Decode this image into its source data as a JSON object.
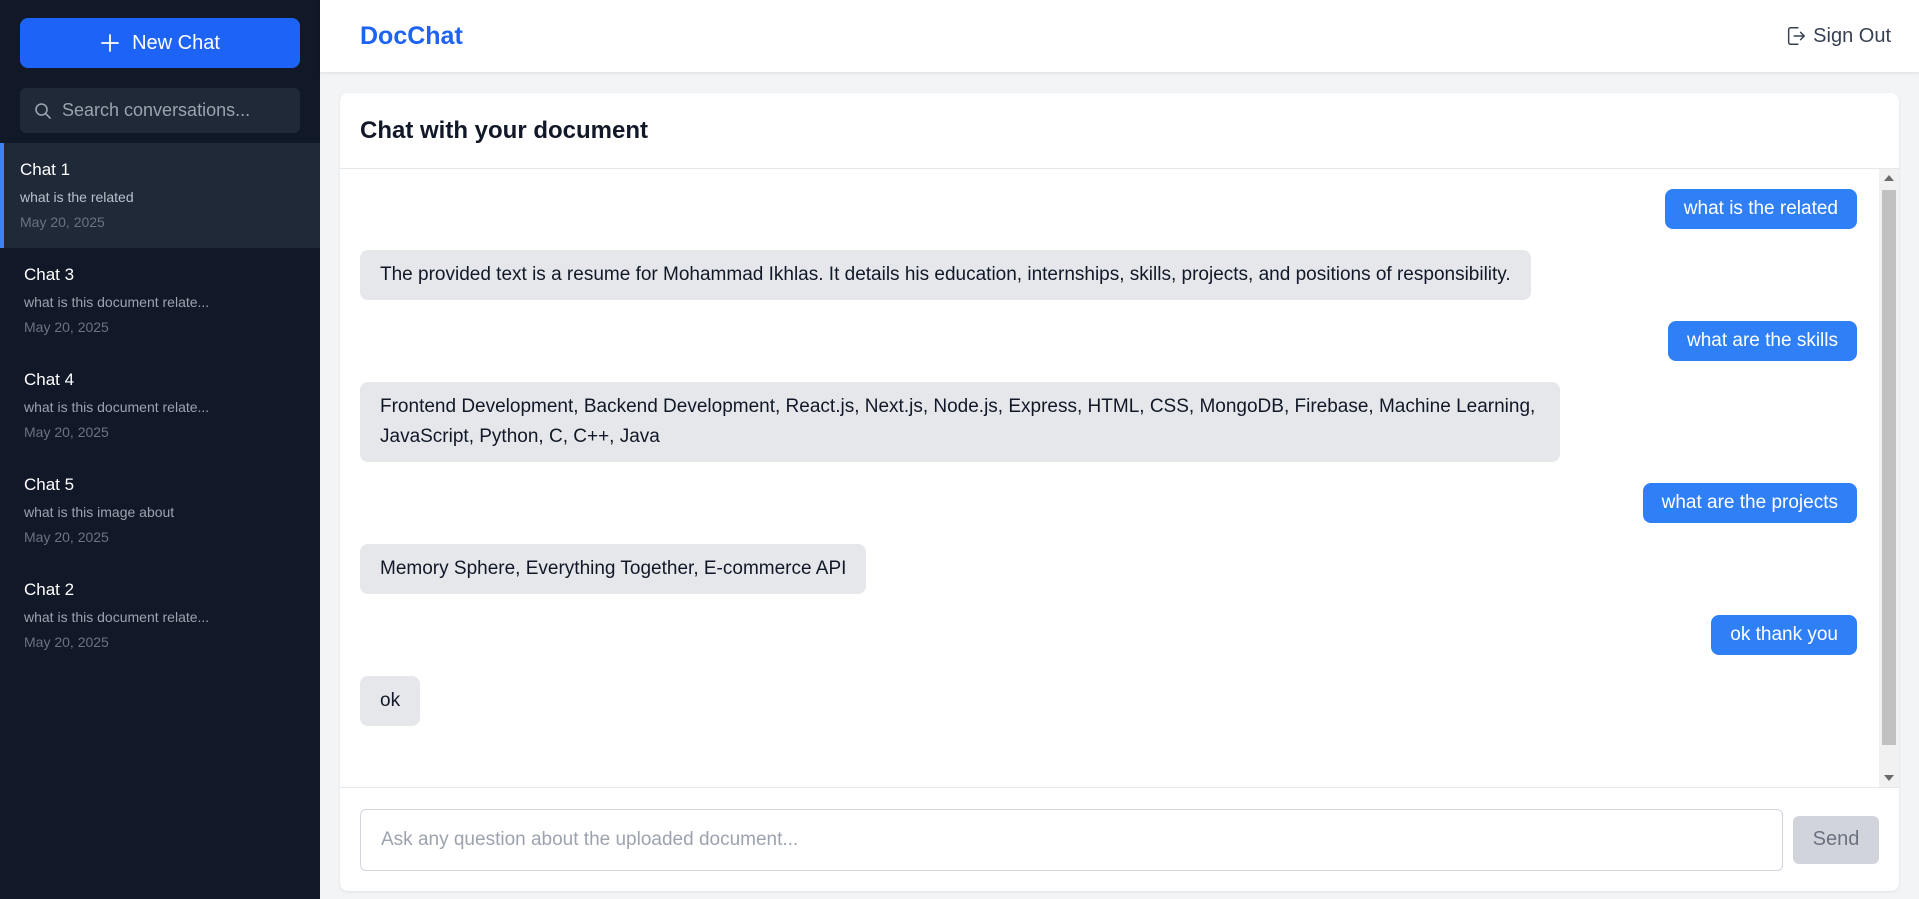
{
  "sidebar": {
    "new_chat_label": "New Chat",
    "search_placeholder": "Search conversations...",
    "conversations": [
      {
        "title": "Chat 1",
        "preview": "what is the related",
        "date": "May 20, 2025",
        "active": true
      },
      {
        "title": "Chat 3",
        "preview": "what is this document relate...",
        "date": "May 20, 2025",
        "active": false
      },
      {
        "title": "Chat 4",
        "preview": "what is this document relate...",
        "date": "May 20, 2025",
        "active": false
      },
      {
        "title": "Chat 5",
        "preview": "what is this image about",
        "date": "May 20, 2025",
        "active": false
      },
      {
        "title": "Chat 2",
        "preview": "what is this document relate...",
        "date": "May 20, 2025",
        "active": false
      }
    ]
  },
  "header": {
    "brand": "DocChat",
    "signout_label": "Sign Out"
  },
  "chat": {
    "title": "Chat with your document",
    "messages": [
      {
        "role": "user",
        "text": "what is the related"
      },
      {
        "role": "bot",
        "text": "The provided text is a resume for Mohammad Ikhlas.  It details his education, internships, skills, projects, and positions of responsibility."
      },
      {
        "role": "user",
        "text": "what are the skills"
      },
      {
        "role": "bot",
        "text": "Frontend Development, Backend Development, React.js, Next.js, Node.js, Express, HTML, CSS, MongoDB, Firebase, Machine Learning, JavaScript, Python, C, C++, Java"
      },
      {
        "role": "user",
        "text": "what are the projects"
      },
      {
        "role": "bot",
        "text": "Memory Sphere, Everything Together, E-commerce API"
      },
      {
        "role": "user",
        "text": "ok thank you"
      },
      {
        "role": "bot",
        "text": "ok"
      }
    ],
    "input_placeholder": "Ask any question about the uploaded document...",
    "input_value": "",
    "send_label": "Send"
  },
  "colors": {
    "primary": "#1d63f5",
    "user_bubble": "#2f80f7",
    "bot_bubble": "#e5e7eb",
    "sidebar_bg": "#111827",
    "active_indicator": "#3b82f6"
  },
  "icons": {
    "new_chat": "plus-icon",
    "search": "search-icon",
    "signout": "sign-out-icon"
  }
}
